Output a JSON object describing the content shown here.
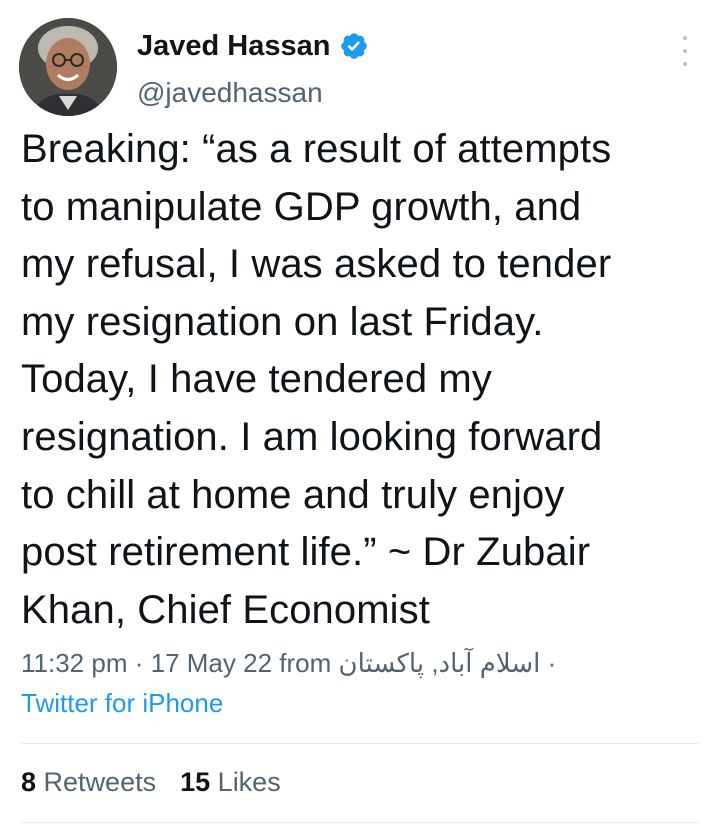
{
  "tweet": {
    "author": {
      "display_name": "Javed Hassan",
      "handle": "@javedhassan",
      "verified": true
    },
    "text": "Breaking: “as a result of attempts\nto manipulate GDP growth, and\nmy refusal, I was asked to tender\nmy resignation on last Friday.\nToday, I have tendered my\nresignation. I am looking forward\nto chill at home and truly enjoy\npost retirement life.” ~ Dr Zubair\nKhan, Chief Economist",
    "time": "11:32 pm",
    "separator": "·",
    "date": "17 May 22",
    "from_label": "from",
    "location": "اسلام آباد, پاکستان",
    "location_separator": "·",
    "source": "Twitter for iPhone",
    "stats": {
      "retweets_count": "8",
      "retweets_label": "Retweets",
      "likes_count": "15",
      "likes_label": "Likes"
    }
  },
  "colors": {
    "text_primary": "#0f1419",
    "text_secondary": "#536471",
    "accent": "#1d9bf0",
    "divider": "#e6ecf0"
  },
  "icons": {
    "verified": "verified-badge-icon",
    "more": "more-options-icon"
  }
}
